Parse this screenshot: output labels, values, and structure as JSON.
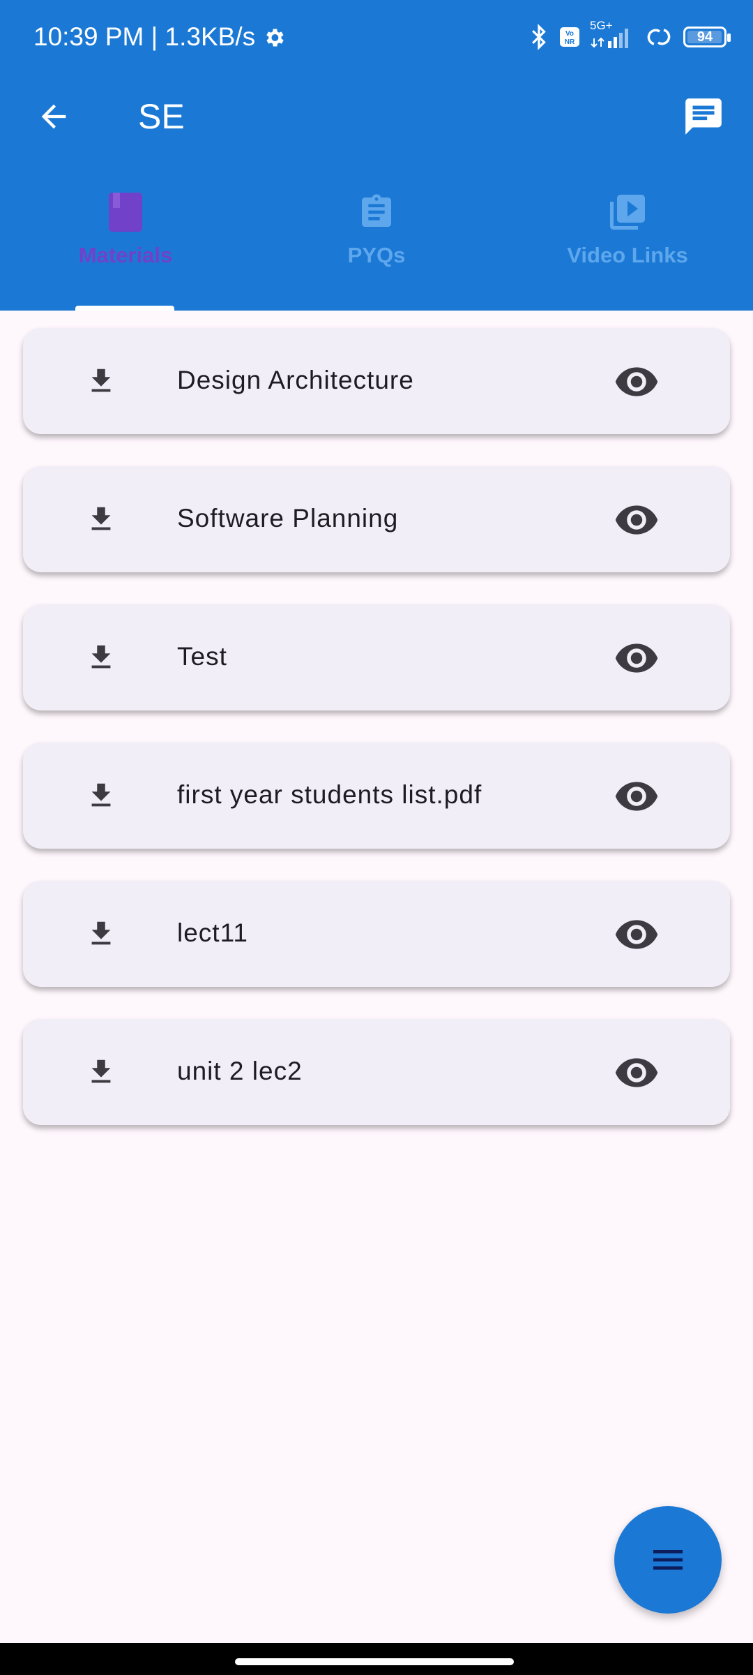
{
  "status_bar": {
    "time_speed": "10:39 PM | 1.3KB/s",
    "network": "5G+",
    "volte": "Vo NR",
    "battery": "94"
  },
  "toolbar": {
    "title": "SE"
  },
  "tabs": [
    {
      "label": "Materials",
      "icon": "book-icon",
      "active": true
    },
    {
      "label": "PYQs",
      "icon": "clipboard-icon",
      "active": false
    },
    {
      "label": "Video Links",
      "icon": "video-library-icon",
      "active": false
    }
  ],
  "materials": [
    {
      "name": "Design Architecture"
    },
    {
      "name": "Software Planning"
    },
    {
      "name": "Test"
    },
    {
      "name": "first year students list.pdf"
    },
    {
      "name": "lect11"
    },
    {
      "name": "unit 2 lec2"
    }
  ],
  "colors": {
    "primary": "#1b79d5",
    "active_tab": "#7241c9",
    "inactive_tab": "#5ea7ec",
    "card": "#f2eef7",
    "background": "#fef7fc"
  }
}
